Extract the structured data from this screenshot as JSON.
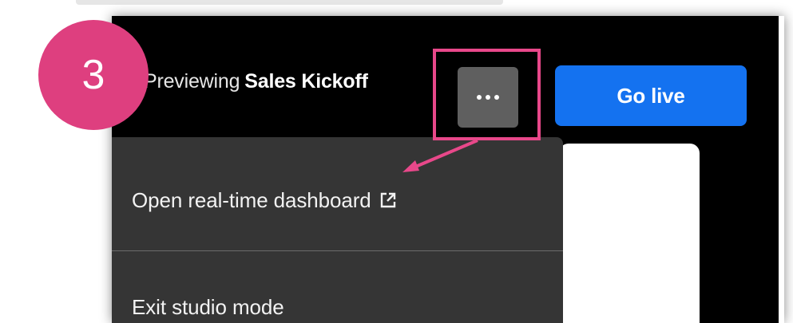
{
  "header": {
    "preview_label": "Previewing",
    "event_name": "Sales Kickoff",
    "go_live_label": "Go live"
  },
  "menu": {
    "items": [
      {
        "label": "Open real-time dashboard",
        "icon": "external-link-icon"
      },
      {
        "label": "Exit studio mode"
      }
    ]
  },
  "annotation": {
    "step_number": "3"
  },
  "colors": {
    "app_bg": "#000000",
    "menu_bg": "#353535",
    "more_button_bg": "#5f5f5f",
    "go_live_blue": "#1472f0",
    "annotation_pink": "#de3f7f"
  },
  "icons": [
    "more-icon",
    "external-link-icon",
    "arrow-icon"
  ]
}
